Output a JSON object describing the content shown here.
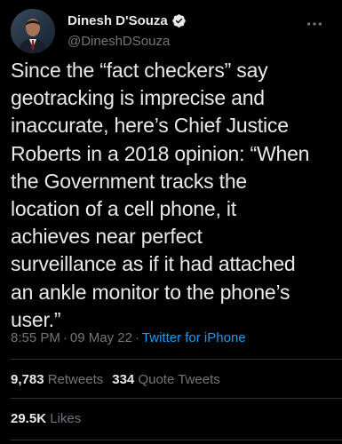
{
  "author": {
    "display_name": "Dinesh D'Souza",
    "handle": "@DineshDSouza",
    "verified": true,
    "avatar": "avatar-photo"
  },
  "tweet": {
    "text": "Since the “fact checkers” say\ngeotracking is imprecise and\ninaccurate, here’s Chief Justice\nRoberts in a 2018 opinion: “When\nthe Government tracks the\nlocation of a cell phone, it\nachieves near perfect\nsurveillance as if it had attached\nan ankle monitor to the phone’s\nuser.”",
    "time": "8:55 PM",
    "separator": "·",
    "date": "09 May 22",
    "source": "Twitter for iPhone"
  },
  "stats": {
    "retweets_count": "9,783",
    "retweets_label": "Retweets",
    "quotes_count": "334",
    "quotes_label": "Quote Tweets",
    "likes_count": "29.5K",
    "likes_label": "Likes"
  },
  "icons": {
    "verified": "verified-badge-icon",
    "more": "more-options-icon"
  },
  "colors": {
    "background": "#000000",
    "text": "#e7e9ea",
    "muted": "#71767b",
    "accent": "#1d9bf0",
    "divider": "#2f3336"
  }
}
